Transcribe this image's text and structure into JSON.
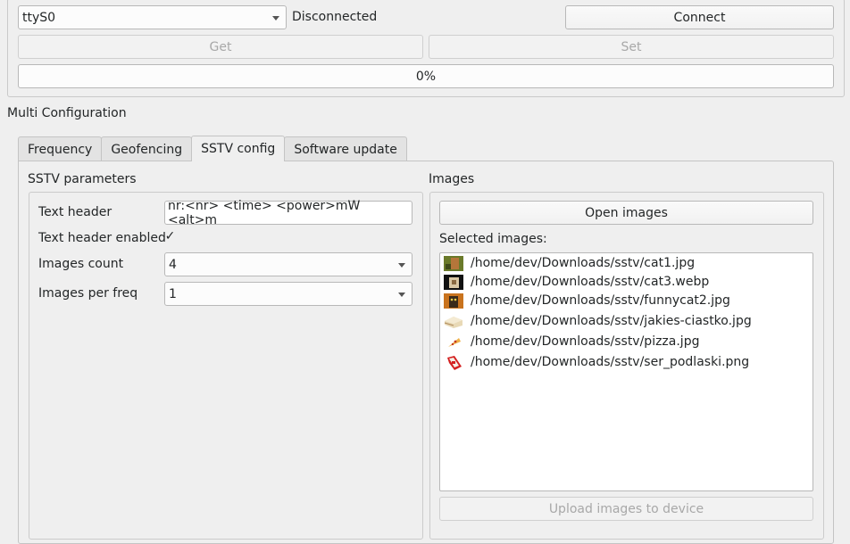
{
  "connection": {
    "port_value": "ttyS0",
    "status": "Disconnected",
    "connect_label": "Connect",
    "get_label": "Get",
    "set_label": "Set",
    "progress_text": "0%",
    "progress": 0
  },
  "section_title": "Multi Configuration",
  "tabs": [
    {
      "label": "Frequency"
    },
    {
      "label": "Geofencing"
    },
    {
      "label": "SSTV config"
    },
    {
      "label": "Software update"
    }
  ],
  "active_tab": "SSTV config",
  "sstv": {
    "group_title": "SSTV parameters",
    "text_header_label": "Text header",
    "text_header_value": "nr:<nr> <time> <power>mW <alt>m",
    "text_header_enabled_label": "Text header enabled",
    "text_header_enabled": true,
    "images_count_label": "Images count",
    "images_count_value": "4",
    "images_per_freq_label": "Images per freq",
    "images_per_freq_value": "1"
  },
  "images": {
    "group_title": "Images",
    "open_label": "Open images",
    "selected_label": "Selected images:",
    "files": [
      {
        "path": "/home/dev/Downloads/sstv/cat1.jpg",
        "icon": "cat-photo-icon"
      },
      {
        "path": "/home/dev/Downloads/sstv/cat3.webp",
        "icon": "cat-photo-icon"
      },
      {
        "path": "/home/dev/Downloads/sstv/funnycat2.jpg",
        "icon": "cat-photo-icon"
      },
      {
        "path": "/home/dev/Downloads/sstv/jakies-ciastko.jpg",
        "icon": "cake-photo-icon"
      },
      {
        "path": "/home/dev/Downloads/sstv/pizza.jpg",
        "icon": "pizza-photo-icon"
      },
      {
        "path": "/home/dev/Downloads/sstv/ser_podlaski.png",
        "icon": "cheese-photo-icon"
      }
    ],
    "upload_label": "Upload images to device"
  }
}
